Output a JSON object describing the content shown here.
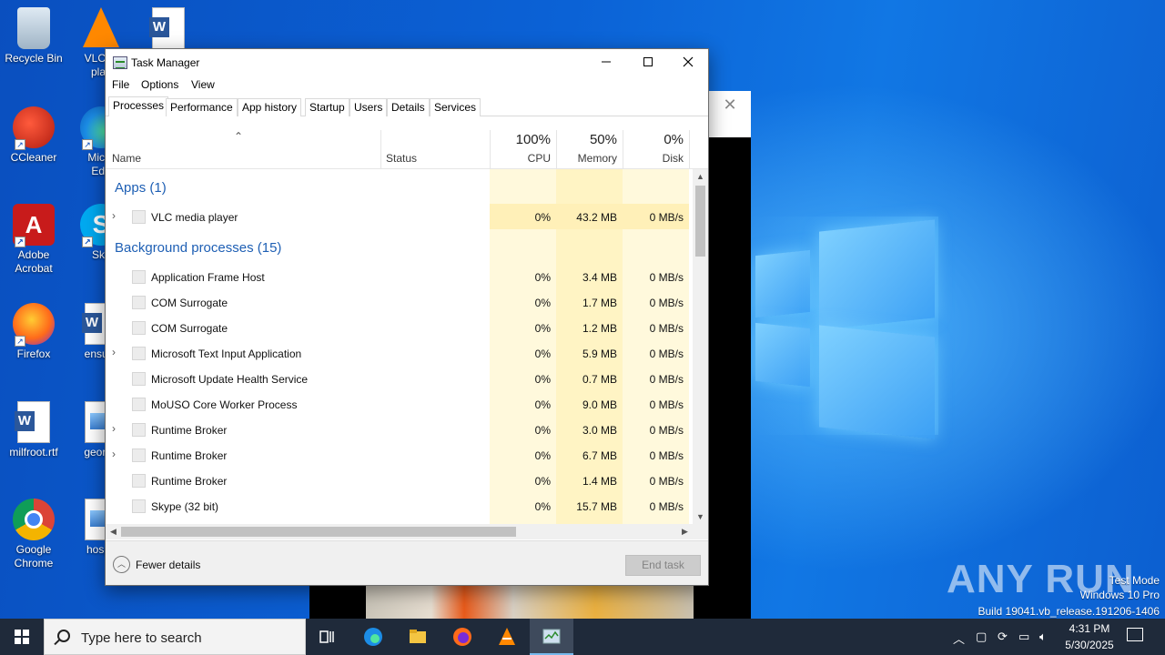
{
  "desktop": {
    "icons": [
      {
        "label": "Recycle Bin",
        "icon": "recycle-bin-icon"
      },
      {
        "label": "CCleaner",
        "icon": "ccleaner-icon"
      },
      {
        "label": "Adobe Acrobat",
        "icon": "adobe-acrobat-icon"
      },
      {
        "label": "Firefox",
        "icon": "firefox-icon"
      },
      {
        "label": "milfroot.rtf",
        "icon": "word-document-icon"
      },
      {
        "label": "Google Chrome",
        "icon": "chrome-icon"
      },
      {
        "label": "VLC m",
        "sub": "play",
        "icon": "vlc-icon"
      },
      {
        "label": "Micro",
        "sub": "Edg",
        "icon": "edge-icon"
      },
      {
        "label": "Sky",
        "icon": "skype-icon"
      },
      {
        "label": "ensure",
        "icon": "word-document-icon"
      },
      {
        "label": "george",
        "icon": "image-file-icon"
      },
      {
        "label": "hospit",
        "icon": "image-file-icon"
      },
      {
        "label": "",
        "icon": "word-document-icon"
      }
    ]
  },
  "task_manager": {
    "title": "Task Manager",
    "menu": [
      "File",
      "Options",
      "View"
    ],
    "tabs": [
      "Processes",
      "Performance",
      "App history",
      "Startup",
      "Users",
      "Details",
      "Services"
    ],
    "active_tab": "Processes",
    "columns": {
      "name": "Name",
      "status": "Status",
      "cpu": {
        "pct": "100%",
        "label": "CPU"
      },
      "memory": {
        "pct": "50%",
        "label": "Memory"
      },
      "disk": {
        "pct": "0%",
        "label": "Disk"
      }
    },
    "groups": {
      "apps": "Apps (1)",
      "background": "Background processes (15)"
    },
    "apps": [
      {
        "name": "VLC media player",
        "cpu": "0%",
        "mem": "43.2 MB",
        "disk": "0 MB/s",
        "expandable": true
      }
    ],
    "background": [
      {
        "name": "Application Frame Host",
        "cpu": "0%",
        "mem": "3.4 MB",
        "disk": "0 MB/s",
        "expandable": false
      },
      {
        "name": "COM Surrogate",
        "cpu": "0%",
        "mem": "1.7 MB",
        "disk": "0 MB/s",
        "expandable": false
      },
      {
        "name": "COM Surrogate",
        "cpu": "0%",
        "mem": "1.2 MB",
        "disk": "0 MB/s",
        "expandable": false
      },
      {
        "name": "Microsoft Text Input Application",
        "cpu": "0%",
        "mem": "5.9 MB",
        "disk": "0 MB/s",
        "expandable": true
      },
      {
        "name": "Microsoft Update Health Service",
        "cpu": "0%",
        "mem": "0.7 MB",
        "disk": "0 MB/s",
        "expandable": false
      },
      {
        "name": "MoUSO Core Worker Process",
        "cpu": "0%",
        "mem": "9.0 MB",
        "disk": "0 MB/s",
        "expandable": false
      },
      {
        "name": "Runtime Broker",
        "cpu": "0%",
        "mem": "3.0 MB",
        "disk": "0 MB/s",
        "expandable": true
      },
      {
        "name": "Runtime Broker",
        "cpu": "0%",
        "mem": "6.7 MB",
        "disk": "0 MB/s",
        "expandable": true
      },
      {
        "name": "Runtime Broker",
        "cpu": "0%",
        "mem": "1.4 MB",
        "disk": "0 MB/s",
        "expandable": false
      },
      {
        "name": "Skype (32 bit)",
        "cpu": "0%",
        "mem": "15.7 MB",
        "disk": "0 MB/s",
        "expandable": false
      }
    ],
    "footer": {
      "fewer_details": "Fewer details",
      "end_task": "End task"
    }
  },
  "watermark": {
    "brand": "ANY RUN",
    "line1": "Test Mode",
    "line2": "Windows 10 Pro",
    "line3": "Build 19041.vb_release.191206-1406"
  },
  "taskbar": {
    "search_placeholder": "Type here to search",
    "apps": [
      "task-view-icon",
      "edge-icon",
      "file-explorer-icon",
      "firefox-icon",
      "vlc-icon",
      "task-manager-icon"
    ],
    "time": "4:31 PM",
    "date": "5/30/2025"
  },
  "colors": {
    "accent_blue_text": "#1e5fb4",
    "heat_yellow": "#fff4c4",
    "taskbar": "#1f2a3a"
  }
}
